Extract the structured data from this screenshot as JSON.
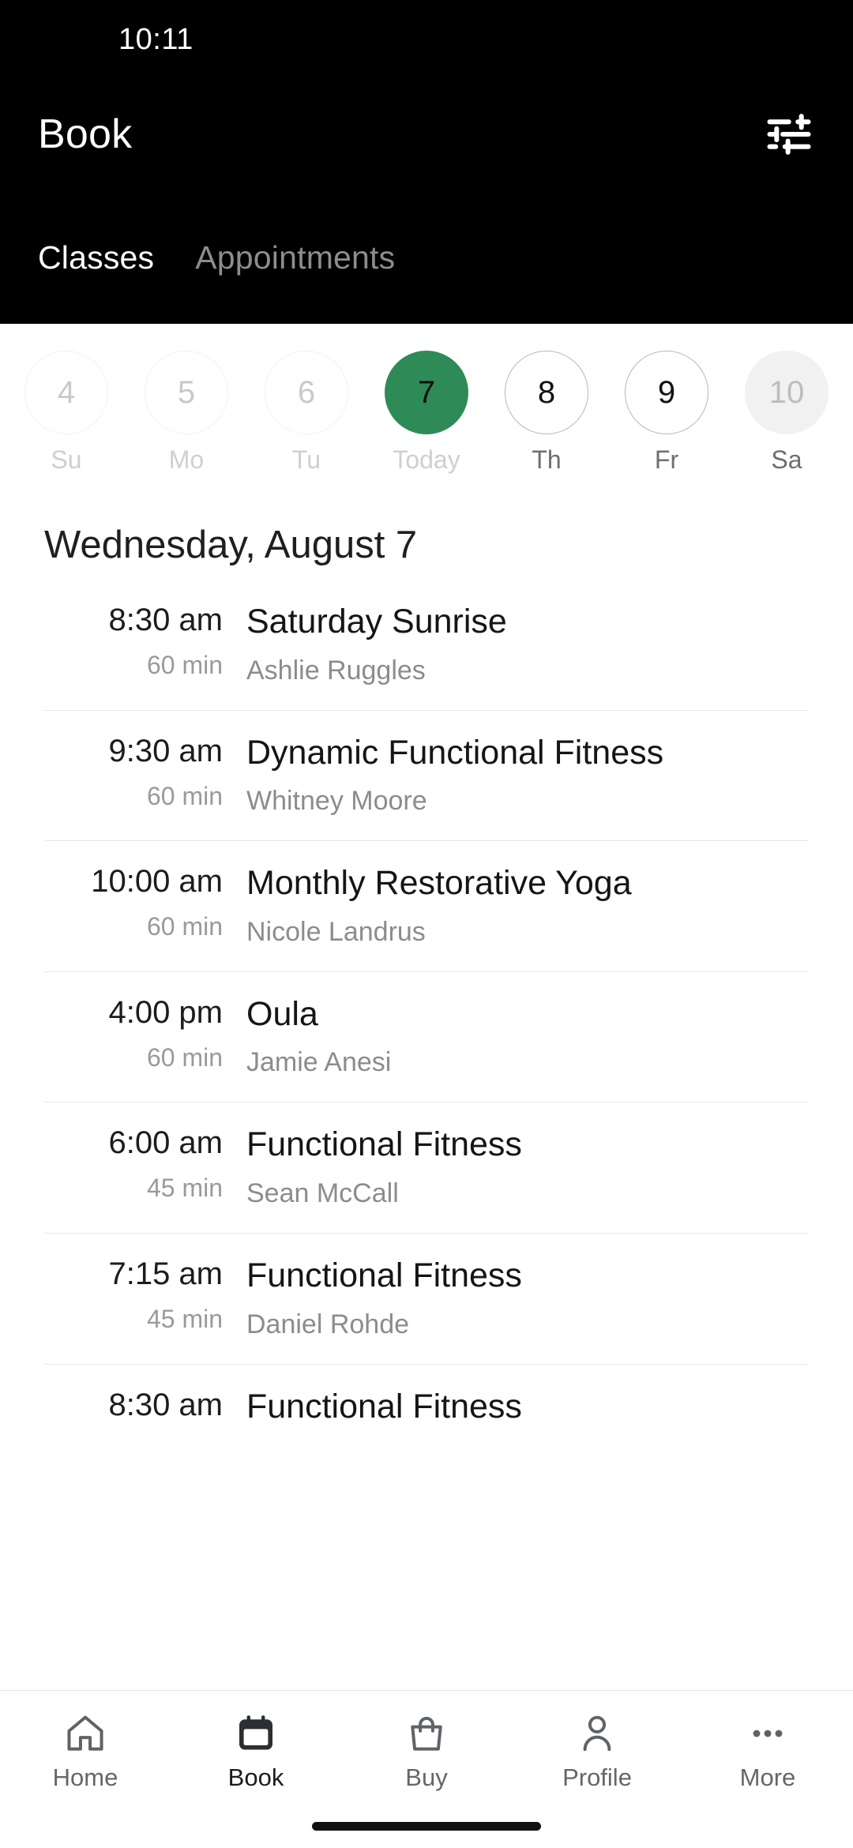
{
  "status_bar": {
    "time": "10:11"
  },
  "header": {
    "title": "Book",
    "filter_icon": "tune-icon",
    "tabs": [
      {
        "label": "Classes",
        "active": true
      },
      {
        "label": "Appointments",
        "active": false
      }
    ]
  },
  "date_strip": {
    "days": [
      {
        "number": "4",
        "label": "Su",
        "state": "past"
      },
      {
        "number": "5",
        "label": "Mo",
        "state": "past"
      },
      {
        "number": "6",
        "label": "Tu",
        "state": "past"
      },
      {
        "number": "7",
        "label": "Today",
        "state": "today"
      },
      {
        "number": "8",
        "label": "Th",
        "state": "future"
      },
      {
        "number": "9",
        "label": "Fr",
        "state": "future"
      },
      {
        "number": "10",
        "label": "Sa",
        "state": "disabled"
      }
    ]
  },
  "day_heading": "Wednesday, August 7",
  "classes": [
    {
      "time": "8:30 am",
      "duration": "60 min",
      "name": "Saturday Sunrise",
      "instructor": "Ashlie Ruggles"
    },
    {
      "time": "9:30 am",
      "duration": "60 min",
      "name": "Dynamic Functional Fitness",
      "instructor": "Whitney Moore"
    },
    {
      "time": "10:00 am",
      "duration": "60 min",
      "name": "Monthly Restorative Yoga",
      "instructor": "Nicole Landrus"
    },
    {
      "time": "4:00 pm",
      "duration": "60 min",
      "name": "Oula",
      "instructor": "Jamie Anesi"
    },
    {
      "time": "6:00 am",
      "duration": "45 min",
      "name": "Functional Fitness",
      "instructor": "Sean McCall"
    },
    {
      "time": "7:15 am",
      "duration": "45 min",
      "name": "Functional Fitness",
      "instructor": "Daniel Rohde"
    },
    {
      "time": "8:30 am",
      "duration": "",
      "name": "Functional Fitness",
      "instructor": ""
    }
  ],
  "bottom_nav": {
    "items": [
      {
        "label": "Home",
        "icon": "home-icon",
        "active": false
      },
      {
        "label": "Book",
        "icon": "calendar-icon",
        "active": true
      },
      {
        "label": "Buy",
        "icon": "bag-icon",
        "active": false
      },
      {
        "label": "Profile",
        "icon": "person-icon",
        "active": false
      },
      {
        "label": "More",
        "icon": "ellipsis-icon",
        "active": false
      }
    ]
  },
  "colors": {
    "header_background": "#000000",
    "accent_green": "#2e8b57",
    "page_background": "#ffffff",
    "muted_text": "#8c8c8c",
    "divider": "#e7e7e7"
  }
}
